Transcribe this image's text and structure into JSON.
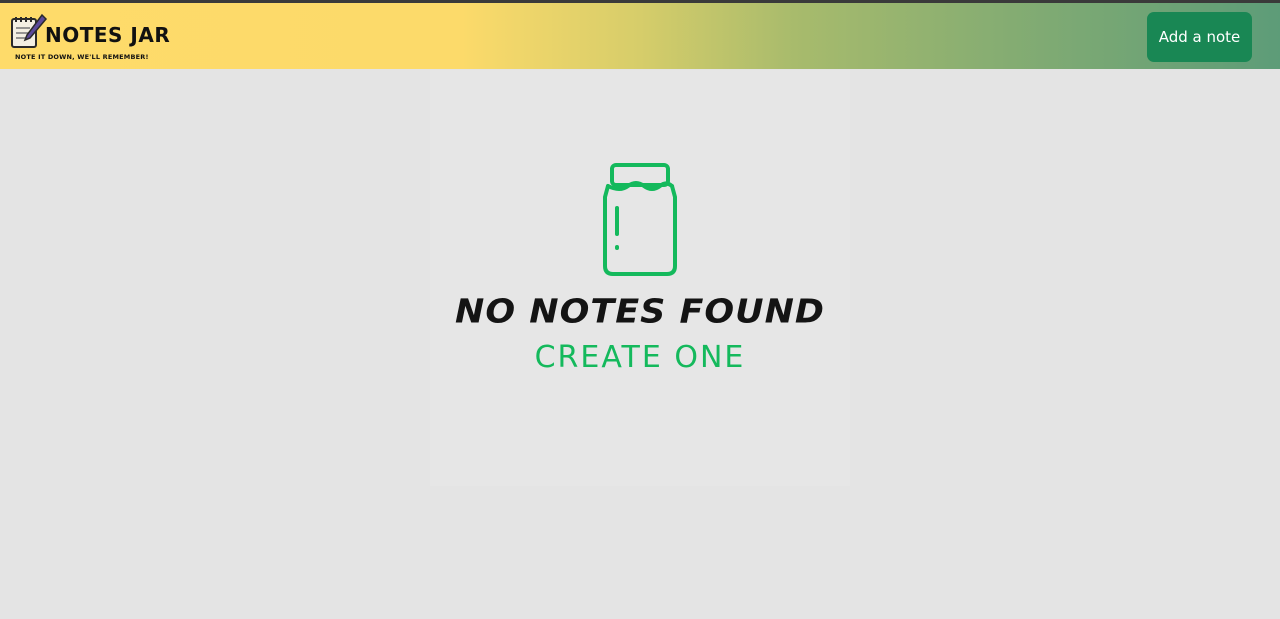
{
  "brand": {
    "title": "NOTES JAR",
    "tagline": "NOTE IT DOWN, WE'LL REMEMBER!",
    "icon": "notepad-pencil-icon"
  },
  "header": {
    "add_button_label": "Add a note"
  },
  "empty_state": {
    "icon": "jar-icon",
    "title": "NO NOTES FOUND",
    "cta": "CREATE ONE"
  },
  "colors": {
    "header_gradient_start": "#fedb6a",
    "header_gradient_end": "#5d9c78",
    "button_bg": "#198754",
    "accent_green": "#14b95c",
    "page_bg": "#e4e4e4"
  }
}
